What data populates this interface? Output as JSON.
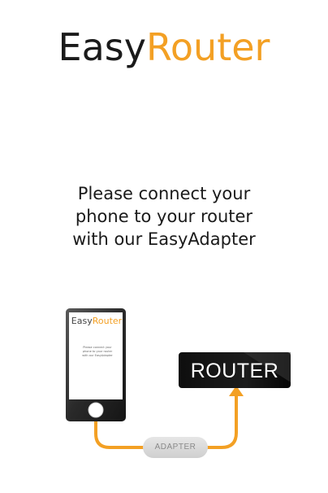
{
  "brand": {
    "part1": "Easy",
    "part2": "Router"
  },
  "instruction": {
    "line1": "Please connect your",
    "line2": "phone to your router",
    "line3": "with our EasyAdapter"
  },
  "illustration": {
    "phone_brand_part1": "Easy",
    "phone_brand_part2": "Router",
    "phone_text_line1": "Please connect your",
    "phone_text_line2": "phone to your router",
    "phone_text_line3": "with our EasyAdapter",
    "router_label": "ROUTER",
    "adapter_label": "ADAPTER"
  },
  "colors": {
    "accent": "#f3a024",
    "text": "#1a1a1a",
    "router_box": "#111111",
    "adapter_pill": "#d9d9d9"
  }
}
